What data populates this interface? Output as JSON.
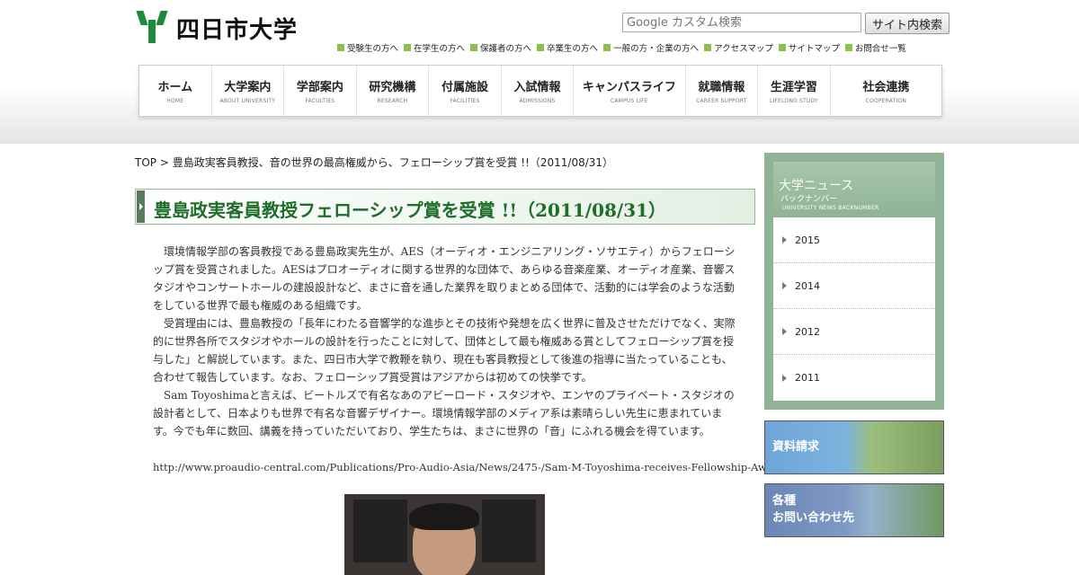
{
  "header": {
    "logo_text": "四日市大学",
    "search_placeholder": "Google カスタム検索",
    "search_button": "サイト内検索",
    "sublinks": [
      "受験生の方へ",
      "在学生の方へ",
      "保護者の方へ",
      "卒業生の方へ",
      "一般の方・企業の方へ",
      "アクセスマップ",
      "サイトマップ",
      "お問合せ一覧"
    ]
  },
  "nav": [
    {
      "jp": "ホーム",
      "en": "HOME"
    },
    {
      "jp": "大学案内",
      "en": "ABOUT UNIVERSITY"
    },
    {
      "jp": "学部案内",
      "en": "FACULTIES"
    },
    {
      "jp": "研究機構",
      "en": "RESEARCH"
    },
    {
      "jp": "付属施設",
      "en": "FACILITIES"
    },
    {
      "jp": "入試情報",
      "en": "ADMISSIONS"
    },
    {
      "jp": "キャンパスライフ",
      "en": "CAMPUS LIFE"
    },
    {
      "jp": "就職情報",
      "en": "CAREER SUPPORT"
    },
    {
      "jp": "生涯学習",
      "en": "LIFELONG STUDY"
    },
    {
      "jp": "社会連携",
      "en": "COOPERATION"
    }
  ],
  "breadcrumb": "TOP > 豊島政実客員教授、音の世界の最高権威から、フェローシップ賞を受賞 !!（2011/08/31）",
  "article": {
    "title": "豊島政実客員教授フェローシップ賞を受賞 !!（2011/08/31）",
    "paragraphs": [
      "環境情報学部の客員教授である豊島政実先生が、AES（オーディオ・エンジニアリング・ソサエティ）からフェローシップ賞を受賞されました。AESはプロオーディオに関する世界的な団体で、あらゆる音楽産業、オーディオ産業、音響スタジオやコンサートホールの建設設計など、まさに音を通した業界を取りまとめる団体で、活動的には学会のような活動をしている世界で最も権威のある組織です。",
      "受賞理由には、豊島教授の「長年にわたる音響学的な進歩とその技術や発想を広く世界に普及させただけでなく、実際的に世界各所でスタジオやホールの設計を行ったことに対して、団体として最も権威ある賞としてフェローシップ賞を授与した」と解説しています。また、四日市大学で教鞭を執り、現在も客員教授として後進の指導に当たっていることも、合わせて報告しています。なお、フェローシップ賞受賞はアジアからは初めての快挙です。",
      "Sam Toyoshimaと言えば、ビートルズで有名なあのアビーロード・スタジオや、エンヤのプライベート・スタジオの設計者として、日本よりも世界で有名な音響デザイナー。環境情報学部のメディア系は素晴らしい先生に恵まれています。今でも年に数回、講義を持っていただいており、学生たちは、まさに世界の「音」にふれる機会を得ています。"
    ],
    "url": "http://www.proaudio-central.com/Publications/Pro-Audio-Asia/News/2475-/Sam-M-Toyoshima-receives-Fellowship-Award-from-AES"
  },
  "sidebar": {
    "title": "大学ニュース",
    "subtitle": "バックナンバー",
    "en": "UNIVERSITY NEWS BACKNUMBER",
    "years": [
      "2015",
      "2014",
      "2012",
      "2011"
    ]
  },
  "banners": {
    "request": "資料請求",
    "contact_line1": "各種",
    "contact_line2": "お問い合わせ先"
  },
  "colors": {
    "accent": "#1e6e2a",
    "sidebar": "#8fb394",
    "logo_green": "#1e8a3c"
  }
}
